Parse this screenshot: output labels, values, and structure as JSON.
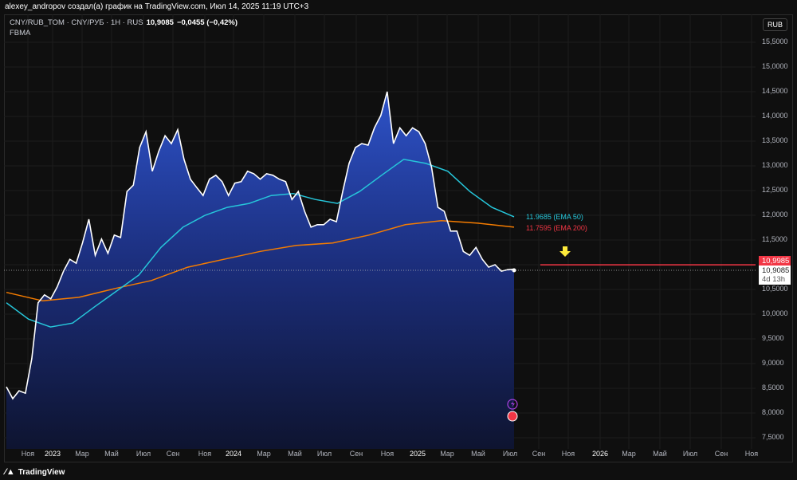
{
  "header": {
    "attribution": "alexey_andropov создал(а) график на TradingView.com, Июл 14, 2025 11:19 UTC+3"
  },
  "legend": {
    "symbol": "CNY/RUB_TOM · CNY/РУБ · 1H · RUS",
    "price": "10,9085",
    "change": "−0,0455 (−0,42%)",
    "indicator": "FBMA"
  },
  "currency": "RUB",
  "price_axis": [
    "15,5000",
    "15,0000",
    "14,5000",
    "14,0000",
    "13,5000",
    "13,0000",
    "12,5000",
    "12,0000",
    "11,5000",
    "11,0000",
    "10,5000",
    "10,0000",
    "9,5000",
    "9,0000",
    "8,5000",
    "8,0000",
    "7,5000"
  ],
  "time_axis": [
    "Ноя",
    "2023",
    "Мар",
    "Май",
    "Июл",
    "Сен",
    "Ноя",
    "2024",
    "Мар",
    "Май",
    "Июл",
    "Сен",
    "Ноя",
    "2025",
    "Мар",
    "Май",
    "Июл",
    "Сен",
    "Ноя",
    "2026",
    "Мар",
    "Май",
    "Июл",
    "Сен",
    "Ноя"
  ],
  "ema50": {
    "label": "11.9685 (EMA 50)",
    "color": "#26c6da",
    "values": [
      10.23,
      9.9,
      9.74,
      9.82,
      10.15,
      10.47,
      10.79,
      11.35,
      11.76,
      12.0,
      12.16,
      12.24,
      12.4,
      12.44,
      12.32,
      12.24,
      12.48,
      12.81,
      13.13,
      13.05,
      12.89,
      12.48,
      12.16,
      11.97
    ]
  },
  "ema200": {
    "label": "11.7595 (EMA 200)",
    "color": "#f57c00",
    "values": [
      10.44,
      10.27,
      10.34,
      10.52,
      10.68,
      10.95,
      11.11,
      11.27,
      11.39,
      11.44,
      11.6,
      11.81,
      11.89,
      11.84,
      11.76
    ]
  },
  "price_series": [
    8.53,
    8.29,
    8.45,
    8.4,
    9.1,
    10.23,
    10.39,
    10.31,
    10.55,
    10.87,
    11.11,
    11.03,
    11.44,
    11.92,
    11.19,
    11.52,
    11.23,
    11.6,
    11.55,
    12.48,
    12.61,
    13.37,
    13.69,
    12.89,
    13.29,
    13.61,
    13.45,
    13.73,
    13.13,
    12.73,
    12.56,
    12.4,
    12.73,
    12.81,
    12.68,
    12.4,
    12.65,
    12.68,
    12.89,
    12.84,
    12.73,
    12.84,
    12.81,
    12.73,
    12.68,
    12.32,
    12.48,
    12.08,
    11.76,
    11.81,
    11.81,
    11.92,
    11.87,
    12.48,
    13.05,
    13.37,
    13.45,
    13.42,
    13.77,
    14.02,
    14.5,
    13.45,
    13.77,
    13.61,
    13.77,
    13.69,
    13.45,
    12.97,
    12.16,
    12.08,
    11.68,
    11.68,
    11.27,
    11.19,
    11.35,
    11.11,
    10.95,
    11.0,
    10.87,
    10.9,
    10.91
  ],
  "alert_line": {
    "value": 10.9985,
    "label": "10,9985",
    "color": "#f23645"
  },
  "last_price": {
    "label": "10,9085",
    "countdown": "4d 13h"
  },
  "footer": {
    "brand": "TradingView"
  }
}
